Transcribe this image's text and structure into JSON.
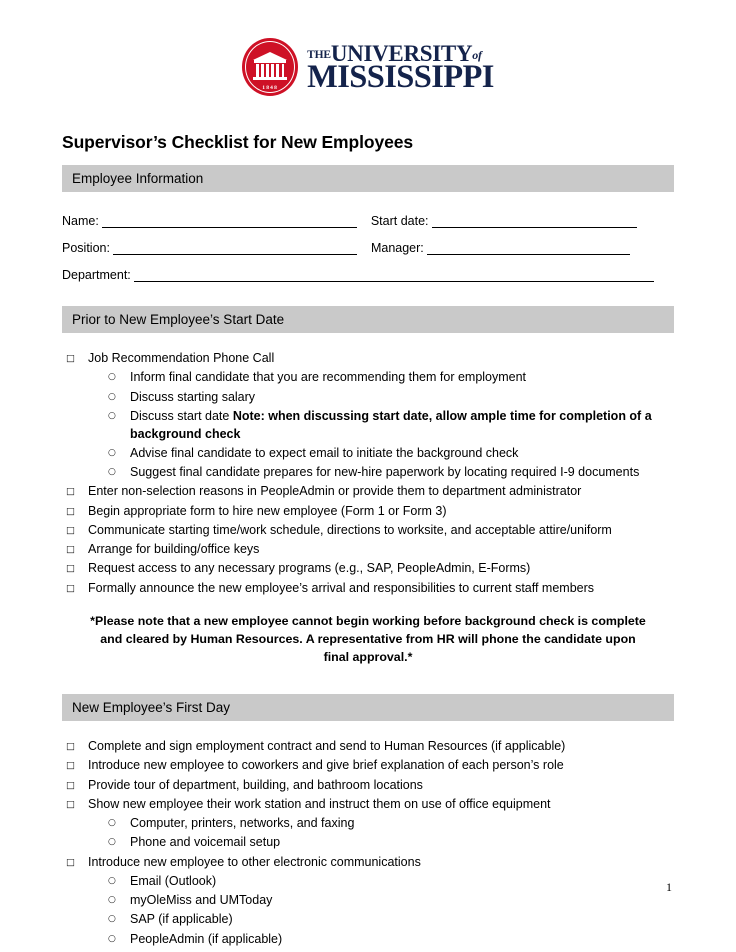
{
  "logo": {
    "seal_year": "1848",
    "the": "THE",
    "university": "UNIVERSITY",
    "of": "of",
    "mississippi": "MISSISSIPPI",
    "brand_red": "#ce1126",
    "brand_navy": "#14234b"
  },
  "document": {
    "title": "Supervisor’s Checklist for New Employees",
    "page_number": "1",
    "section_bar_color": "#c9c9c9"
  },
  "employee_information": {
    "heading": "Employee Information",
    "fields": {
      "name": "Name:",
      "start_date": "Start date:",
      "position": "Position:",
      "manager": "Manager:",
      "department": "Department:"
    },
    "values": {
      "name": "",
      "start_date": "",
      "position": "",
      "manager": "",
      "department": ""
    }
  },
  "prior_to_start": {
    "heading": "Prior to New Employee’s Start Date",
    "items": [
      {
        "level": 1,
        "text": "Job Recommendation Phone Call"
      },
      {
        "level": 2,
        "text": "Inform final candidate that you are recommending them for employment"
      },
      {
        "level": 2,
        "text": "Discuss starting salary"
      },
      {
        "level": 2,
        "text": "Discuss start date ",
        "bold_suffix": "Note: when discussing start date, allow ample time for completion of a background check"
      },
      {
        "level": 2,
        "text": "Advise final candidate to expect email to initiate the background check"
      },
      {
        "level": 2,
        "text": "Suggest final candidate prepares for new-hire paperwork by locating required I-9 documents"
      },
      {
        "level": 1,
        "text": "Enter non-selection reasons in PeopleAdmin or provide them to department administrator"
      },
      {
        "level": 1,
        "text": "Begin appropriate form to hire new employee (Form 1 or Form 3)"
      },
      {
        "level": 1,
        "text": "Communicate starting time/work schedule, directions to worksite, and acceptable attire/uniform"
      },
      {
        "level": 1,
        "text": "Arrange for building/office keys"
      },
      {
        "level": 1,
        "text": "Request access to any necessary programs (e.g., SAP, PeopleAdmin, E-Forms)"
      },
      {
        "level": 1,
        "text": "Formally announce the new employee’s arrival and responsibilities to current staff members"
      }
    ],
    "note": "*Please note that a new employee cannot begin working before background check is complete and cleared by Human Resources. A representative from HR will phone the candidate upon final approval.*"
  },
  "first_day": {
    "heading": "New Employee’s First Day",
    "items": [
      {
        "level": 1,
        "text": "Complete and sign employment contract and send to Human Resources (if applicable)"
      },
      {
        "level": 1,
        "text": "Introduce new employee to coworkers and give brief explanation of each person’s role"
      },
      {
        "level": 1,
        "text": "Provide tour of department, building, and bathroom locations"
      },
      {
        "level": 1,
        "text": "Show new employee their work station and instruct them on use of office equipment"
      },
      {
        "level": 2,
        "text": "Computer, printers, networks, and faxing"
      },
      {
        "level": 2,
        "text": "Phone and voicemail setup"
      },
      {
        "level": 1,
        "text": "Introduce new employee to other electronic communications"
      },
      {
        "level": 2,
        "text": "Email (Outlook)"
      },
      {
        "level": 2,
        "text": "myOleMiss and UMToday"
      },
      {
        "level": 2,
        "text": "SAP (if applicable)"
      },
      {
        "level": 2,
        "text": "PeopleAdmin (if applicable)"
      }
    ]
  },
  "markers": {
    "checkbox": "□",
    "circle": "○"
  }
}
